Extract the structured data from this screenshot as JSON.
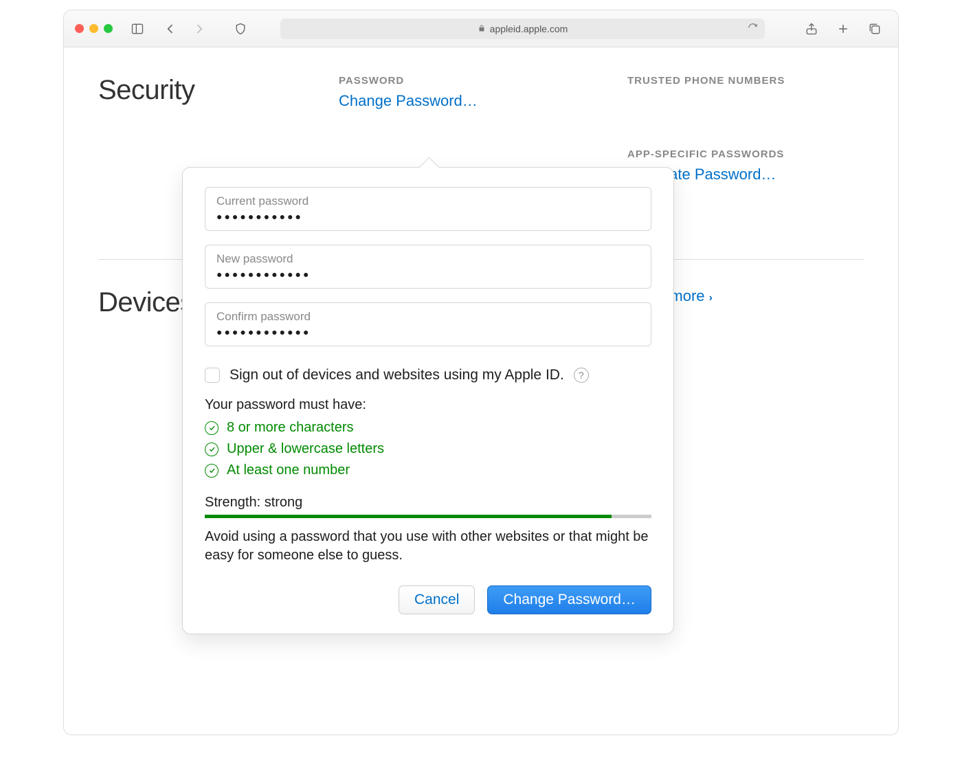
{
  "browser": {
    "url": "appleid.apple.com"
  },
  "page": {
    "security_heading": "Security",
    "password_label": "PASSWORD",
    "change_password_link": "Change Password…",
    "trusted_label": "TRUSTED PHONE NUMBERS",
    "app_specific_label": "APP-SPECIFIC PASSWORDS",
    "generate_password_link": "Generate Password…",
    "devices_heading": "Devices",
    "learn_more": "Learn more"
  },
  "popover": {
    "fields": {
      "current": {
        "label": "Current password",
        "mask": "●●●●●●●●●●●"
      },
      "newpw": {
        "label": "New password",
        "mask": "●●●●●●●●●●●●"
      },
      "confirm": {
        "label": "Confirm password",
        "mask": "●●●●●●●●●●●●"
      }
    },
    "signout_text": "Sign out of devices and websites using my Apple ID.",
    "req_title": "Your password must have:",
    "reqs": {
      "r1": "8 or more characters",
      "r2": "Upper & lowercase letters",
      "r3": "At least one number"
    },
    "strength_label": "Strength: strong",
    "strength_percent": 91,
    "advice": "Avoid using a password that you use with other websites or that might be easy for someone else to guess.",
    "cancel": "Cancel",
    "submit": "Change Password…"
  }
}
